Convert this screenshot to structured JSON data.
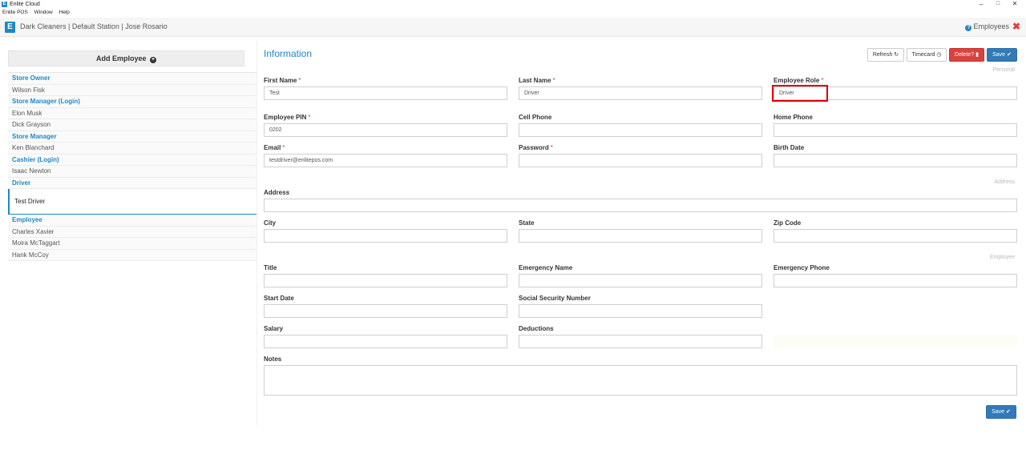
{
  "window": {
    "title": "Enlite Cloud",
    "icon": "E",
    "minimize": "–",
    "restore": "□",
    "close": "✕"
  },
  "menu": [
    "Enlite POS",
    "Window",
    "Help"
  ],
  "header": {
    "logo": "E",
    "store_info": "Dark Cleaners | Default Station | Jose Rosario",
    "section": "Employees",
    "help_icon": "?",
    "close_icon": "✖"
  },
  "sidebar": {
    "add_label": "Add Employee",
    "add_icon": "+",
    "groups": [
      {
        "role": "Store Owner",
        "employees": [
          "Wilson Fisk"
        ]
      },
      {
        "role": "Store Manager (Login)",
        "employees": [
          "Elon Musk",
          "Dick Grayson"
        ]
      },
      {
        "role": "Store Manager",
        "employees": [
          "Ken Blanchard"
        ]
      },
      {
        "role": "Cashier (Login)",
        "employees": [
          "Isaac Newton"
        ]
      },
      {
        "role": "Driver",
        "employees": [
          "Test Driver"
        ]
      },
      {
        "role": "Employee",
        "employees": [
          "Charles Xavier",
          "Moira McTaggart",
          "Hank McCoy"
        ]
      }
    ],
    "selected": "Test Driver"
  },
  "main": {
    "title": "Information",
    "buttons": {
      "refresh": "Refresh ↻",
      "timecard": "Timecard ◷",
      "delete": "Delete? ▮",
      "save": "Save ✔"
    },
    "sections": {
      "personal": "Personal",
      "address": "Address",
      "employee": "Employee"
    },
    "fields": {
      "first_name": {
        "label": "First Name",
        "value": "Test",
        "required": "*"
      },
      "last_name": {
        "label": "Last Name",
        "value": "Driver",
        "required": "*"
      },
      "employee_role": {
        "label": "Employee Role",
        "value": "Driver",
        "required": "*"
      },
      "employee_pin": {
        "label": "Employee PIN",
        "value": "0202",
        "required": "*"
      },
      "cell_phone": {
        "label": "Cell Phone",
        "value": ""
      },
      "home_phone": {
        "label": "Home Phone",
        "value": ""
      },
      "email": {
        "label": "Email",
        "value": "testdriver@enlitepos.com",
        "required": "*"
      },
      "password": {
        "label": "Password",
        "value": "",
        "required": "*"
      },
      "birth_date": {
        "label": "Birth Date",
        "value": ""
      },
      "address": {
        "label": "Address",
        "value": ""
      },
      "city": {
        "label": "City",
        "value": ""
      },
      "state": {
        "label": "State",
        "value": ""
      },
      "zip": {
        "label": "Zip Code",
        "value": ""
      },
      "title": {
        "label": "Title",
        "value": ""
      },
      "emergency_name": {
        "label": "Emergency Name",
        "value": ""
      },
      "emergency_phone": {
        "label": "Emergency Phone",
        "value": ""
      },
      "start_date": {
        "label": "Start Date",
        "value": ""
      },
      "ssn": {
        "label": "Social Security Number",
        "value": ""
      },
      "salary": {
        "label": "Salary",
        "value": ""
      },
      "deductions": {
        "label": "Deductions",
        "value": ""
      },
      "notes": {
        "label": "Notes",
        "value": ""
      }
    }
  }
}
